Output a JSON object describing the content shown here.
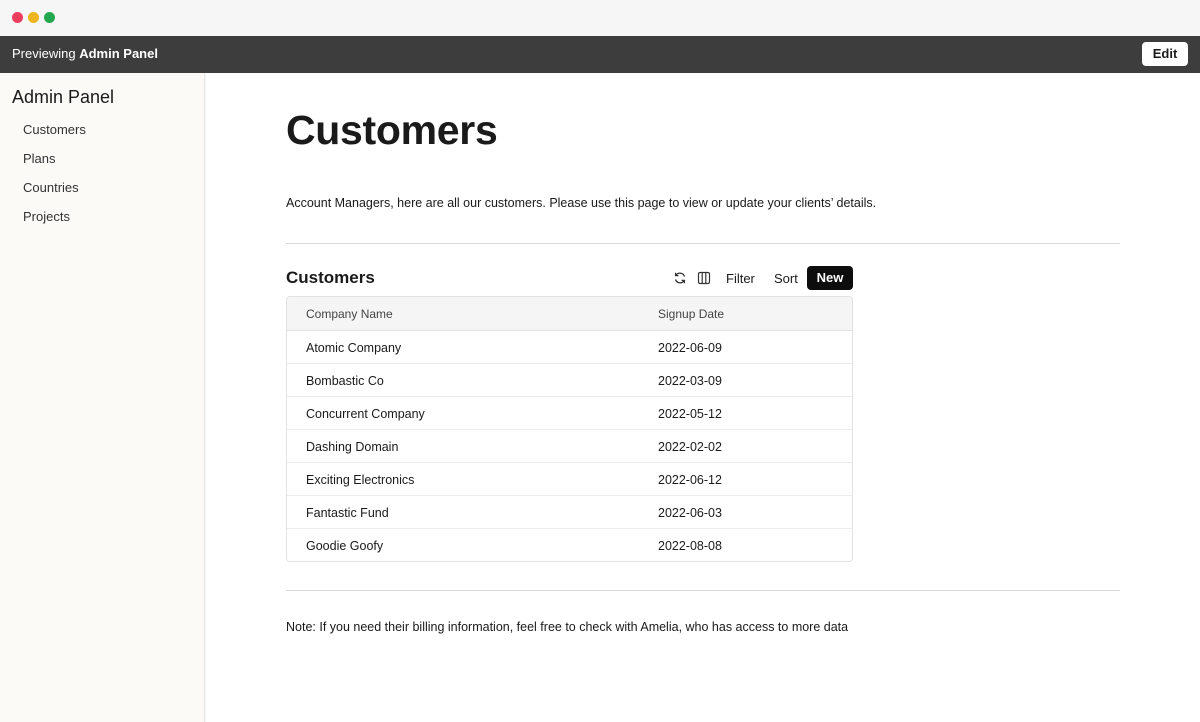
{
  "window": {
    "controls": [
      "close",
      "minimize",
      "maximize"
    ]
  },
  "preview_bar": {
    "prefix": "Previewing",
    "app_name": "Admin Panel",
    "edit_label": "Edit"
  },
  "sidebar": {
    "title": "Admin Panel",
    "items": [
      {
        "label": "Customers"
      },
      {
        "label": "Plans"
      },
      {
        "label": "Countries"
      },
      {
        "label": "Projects"
      }
    ]
  },
  "main": {
    "title": "Customers",
    "intro": "Account Managers, here are all our customers. Please use this page to view or update your clients’ details.",
    "note": "Note: If you need their billing information, feel free to check with Amelia, who has access to more data"
  },
  "table": {
    "heading": "Customers",
    "toolbar": {
      "refresh_icon": "refresh-icon",
      "columns_icon": "columns-icon",
      "filter_label": "Filter",
      "sort_label": "Sort",
      "new_label": "New"
    },
    "columns": [
      "Company Name",
      "Signup Date"
    ],
    "rows": [
      [
        "Atomic Company",
        "2022-06-09"
      ],
      [
        "Bombastic Co",
        "2022-03-09"
      ],
      [
        "Concurrent Company",
        "2022-05-12"
      ],
      [
        "Dashing Domain",
        "2022-02-02"
      ],
      [
        "Exciting Electronics",
        "2022-06-12"
      ],
      [
        "Fantastic Fund",
        "2022-06-03"
      ],
      [
        "Goodie Goofy",
        "2022-08-08"
      ]
    ]
  },
  "colors": {
    "preview_bar": "#3d3d3d",
    "primary_button": "#0d0d0d",
    "sidebar_bg": "#fbfaf7"
  }
}
